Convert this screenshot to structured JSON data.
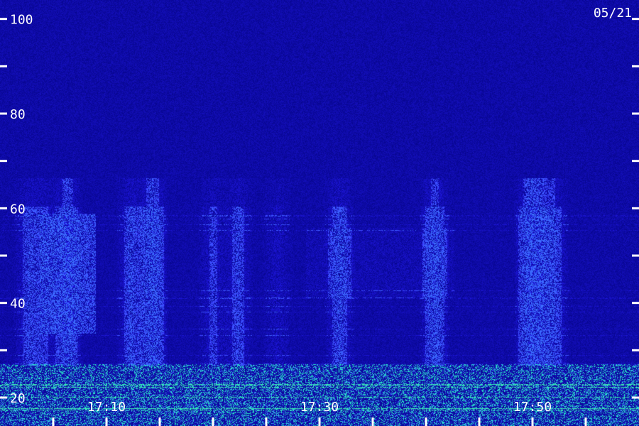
{
  "chart_data": {
    "type": "heatmap",
    "date_label": "05/21",
    "y_ticks": [
      100,
      80,
      60,
      40,
      20
    ],
    "ylim": [
      14,
      104
    ],
    "x_ticks": [
      "17:10",
      "17:30",
      "17:50"
    ],
    "xlim_minutes": [
      1020,
      1080
    ],
    "colors": {
      "background": "#160d5c",
      "noise": "#3a2fd0",
      "signal": "#3f6bff",
      "strong": "#2fe0d0",
      "text": "#ffffff"
    }
  }
}
